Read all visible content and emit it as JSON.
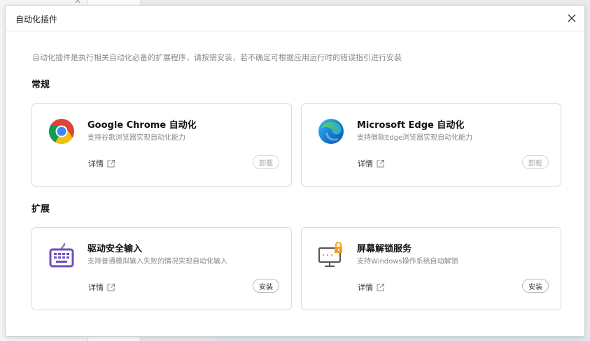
{
  "dialog": {
    "title": "自动化插件",
    "description": "自动化插件是执行相关自动化必备的扩展程序，请按需安装，若不确定可根据应用运行时的错误指引进行安装"
  },
  "sections": {
    "general": "常规",
    "extension": "扩展"
  },
  "cards": {
    "chrome": {
      "title": "Google Chrome 自动化",
      "subtitle": "支持谷歌浏览器实现自动化能力",
      "details": "详情",
      "button": "卸载",
      "icon": "chrome-icon"
    },
    "edge": {
      "title": "Microsoft Edge 自动化",
      "subtitle": "支持微软Edge浏览器实现自动化能力",
      "details": "详情",
      "button": "卸载",
      "icon": "edge-icon"
    },
    "secure_input": {
      "title": "驱动安全输入",
      "subtitle": "支持普通模拟输入失败的情况实现自动化输入",
      "details": "详情",
      "button": "安装",
      "icon": "keyboard-icon"
    },
    "screen_unlock": {
      "title": "屏幕解锁服务",
      "subtitle": "支持Windows操作系统自动解锁",
      "details": "详情",
      "button": "安装",
      "icon": "monitor-lock-icon"
    }
  },
  "colors": {
    "keyboard": "#6b4fbb",
    "lock": "#f0a020",
    "monitor": "#555555"
  }
}
